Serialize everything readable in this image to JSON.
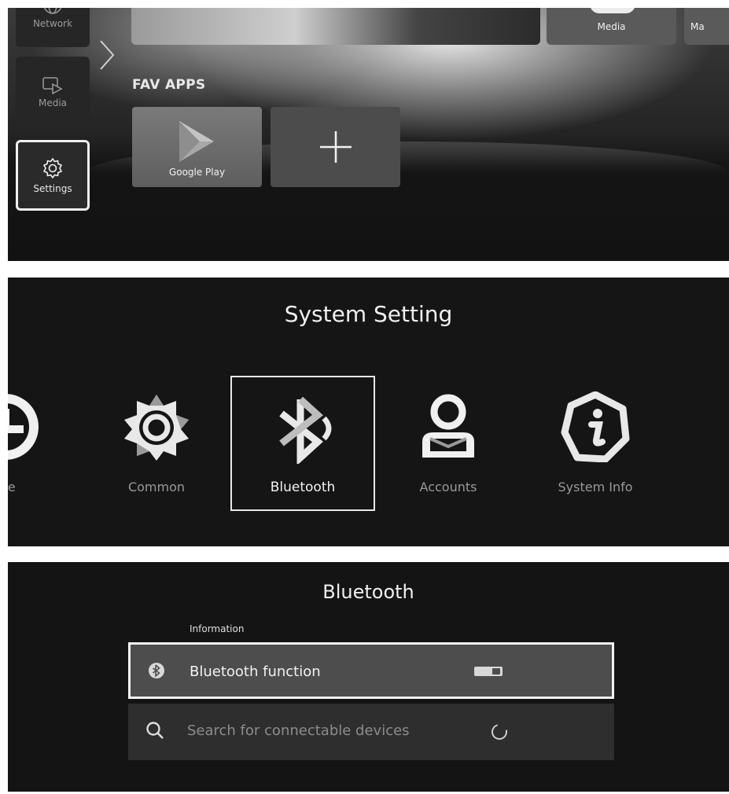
{
  "home": {
    "sidebar": {
      "network_label": "Network",
      "media_label": "Media",
      "settings_label": "Settings"
    },
    "top_row": {
      "media_label": "Media",
      "partial_label": "Ma"
    },
    "fav_apps": {
      "heading": "FAV APPS",
      "apps": [
        {
          "label": "Google Play",
          "icon": "google-play-icon"
        },
        {
          "label": "",
          "icon": "plus-icon"
        }
      ]
    }
  },
  "system_setting": {
    "title": "System Setting",
    "items": [
      {
        "label": "me",
        "icon": "clock-icon",
        "selected": false
      },
      {
        "label": "Common",
        "icon": "gear-icon",
        "selected": false
      },
      {
        "label": "Bluetooth",
        "icon": "bluetooth-icon",
        "selected": true
      },
      {
        "label": "Accounts",
        "icon": "user-icon",
        "selected": false
      },
      {
        "label": "System Info",
        "icon": "info-icon",
        "selected": false
      }
    ]
  },
  "bluetooth": {
    "title": "Bluetooth",
    "section_label": "Information",
    "rows": [
      {
        "label": "Bluetooth function",
        "icon": "bluetooth-icon",
        "control": "toggle",
        "state": "on"
      },
      {
        "label": "Search for connectable devices",
        "icon": "search-icon",
        "control": "spinner"
      }
    ]
  },
  "colors": {
    "background": "#141414",
    "selection_border": "#f0f0f0",
    "tile": "#262626"
  }
}
